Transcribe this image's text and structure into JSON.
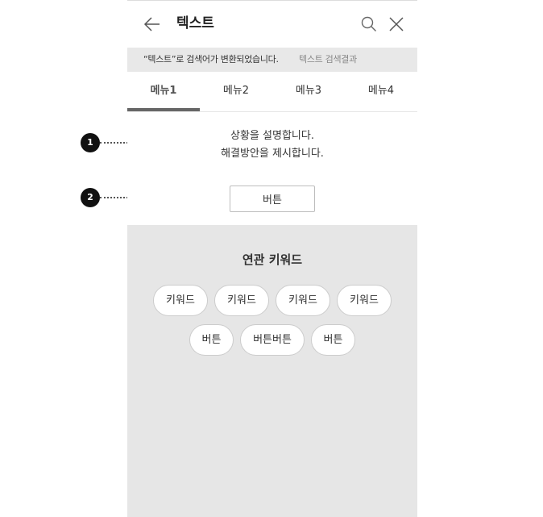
{
  "header": {
    "title": "텍스트"
  },
  "notice": {
    "message": "“텍스트”로 검색어가 변환되었습니다.",
    "link": "텍스트 검색결과"
  },
  "tabs": [
    {
      "label": "메뉴1",
      "active": true
    },
    {
      "label": "메뉴2",
      "active": false
    },
    {
      "label": "메뉴3",
      "active": false
    },
    {
      "label": "메뉴4",
      "active": false
    }
  ],
  "content": {
    "line1": "상황을 설명합니다.",
    "line2": "해결방안을 제시합니다.",
    "button_label": "버튼"
  },
  "related": {
    "title": "연관 키워드",
    "row1": [
      "키워드",
      "키워드",
      "키워드",
      "키워드"
    ],
    "row2": [
      "버튼",
      "버튼버튼",
      "버튼"
    ]
  },
  "annotations": [
    {
      "number": "1"
    },
    {
      "number": "2"
    }
  ],
  "colors": {
    "notice_bg": "#e8e8e8",
    "related_bg": "#e6e6e6",
    "tab_indicator": "#666666",
    "badge": "#111111"
  },
  "icons": {
    "back": "back-arrow-icon",
    "search": "search-icon",
    "close": "close-icon"
  }
}
